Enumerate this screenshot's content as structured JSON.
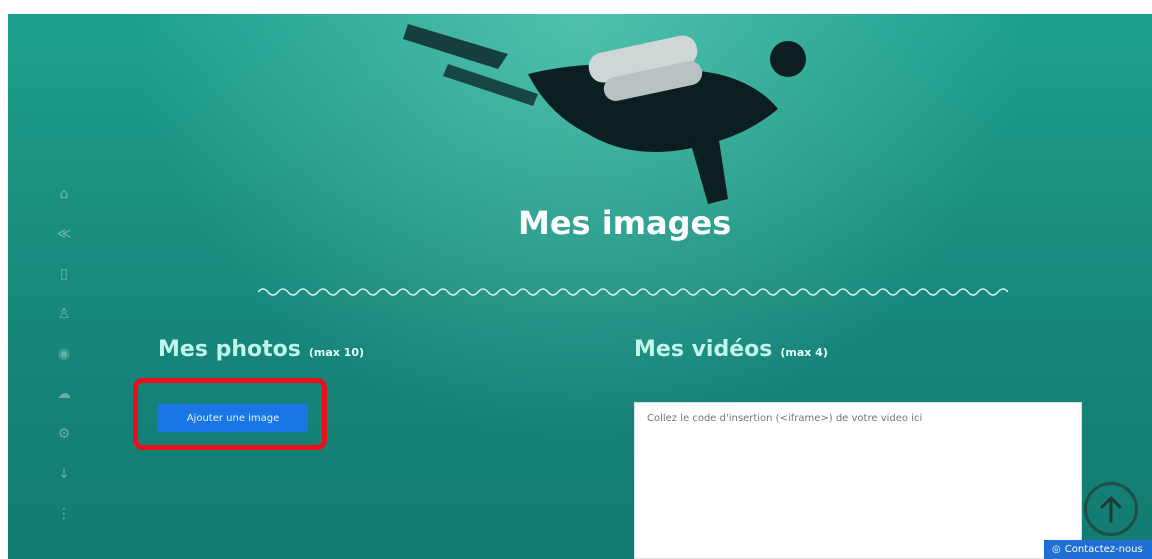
{
  "header": {
    "title": "Mes images"
  },
  "photos": {
    "heading": "Mes photos",
    "max": "(max 10)",
    "add_button": "Ajouter une image"
  },
  "videos": {
    "heading": "Mes vidéos",
    "max": "(max 4)",
    "placeholder": "Collez le code d'insertion (<iframe>) de votre video ici"
  },
  "contact": {
    "label": "Contactez-nous",
    "icon": "chat-icon"
  },
  "sidebar": {
    "icons": [
      "home-icon",
      "share-icon",
      "info-icon",
      "person-icon",
      "eye-icon",
      "cloud-icon",
      "settings-icon",
      "download-icon",
      "more-icon"
    ]
  },
  "colors": {
    "background": "#1a9080",
    "button": "#1976e6",
    "highlight": "#e8101a",
    "contact": "#1f6fd6"
  }
}
